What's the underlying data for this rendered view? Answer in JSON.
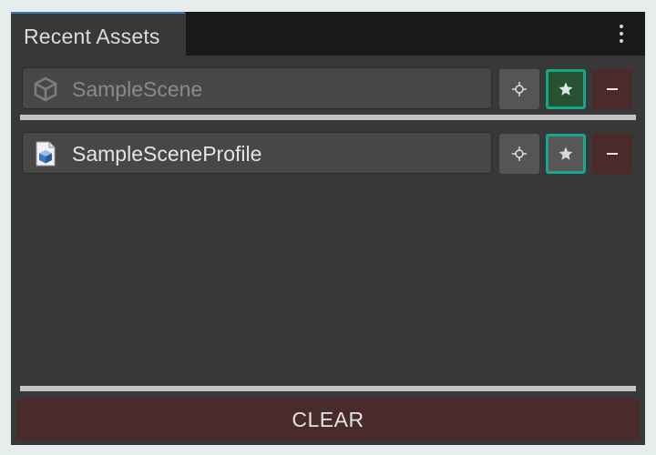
{
  "window": {
    "tab_label": "Recent Assets",
    "menu_icon": "kebab-menu-icon"
  },
  "assets": [
    {
      "name": "SampleScene",
      "icon": "unity-scene-icon",
      "pinned": true,
      "name_color": "#8a8a8a"
    },
    {
      "name": "SampleSceneProfile",
      "icon": "scriptable-object-icon",
      "pinned": false,
      "name_color": "#e4e4e4"
    }
  ],
  "buttons": {
    "ping_icon": "crosshair-icon",
    "favorite_icon": "star-icon",
    "remove_icon": "minus-icon",
    "clear_label": "CLEAR"
  },
  "colors": {
    "accent": "#14a888",
    "tab_highlight": "#3a79bb",
    "danger_bg": "#4a2b2b"
  }
}
